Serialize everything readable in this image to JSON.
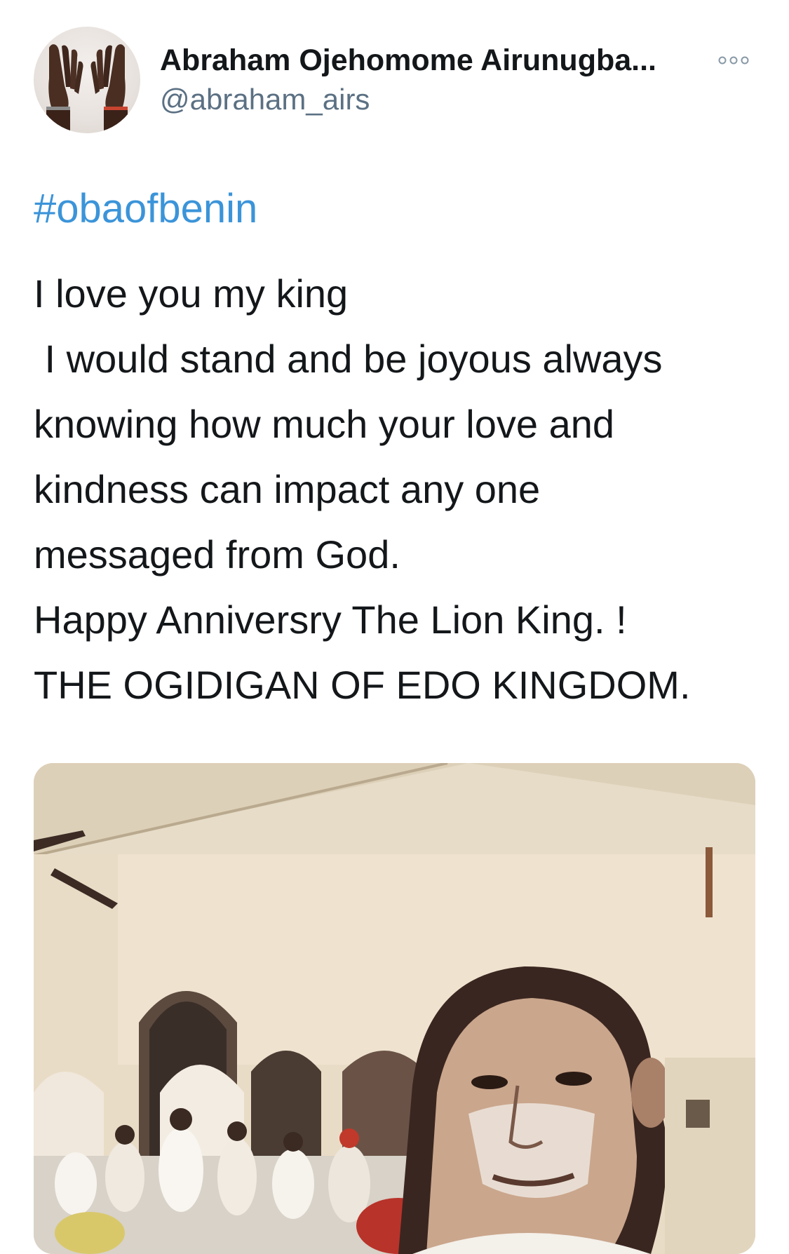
{
  "tweet": {
    "author": {
      "display_name": "Abraham Ojehomome Airunugba...",
      "handle": "@abraham_airs",
      "avatar_icon": "avatar-hands-photo"
    },
    "more_icon": "more-horizontal-icon",
    "hashtag": "#obaofbenin",
    "body_lines": [
      "I love you my king",
      " I would stand and be joyous always",
      "knowing how much your love and",
      "kindness can impact any one",
      "messaged from God.",
      "Happy Anniversry The Lion King. !",
      "THE OGIDIGAN OF EDO KINGDOM."
    ],
    "media": {
      "kind": "photo",
      "icon": "selfie-palace-photo"
    }
  },
  "colors": {
    "text": "#14171a",
    "secondary_text": "#5b7083",
    "link": "#3b94d9",
    "background": "#ffffff"
  }
}
